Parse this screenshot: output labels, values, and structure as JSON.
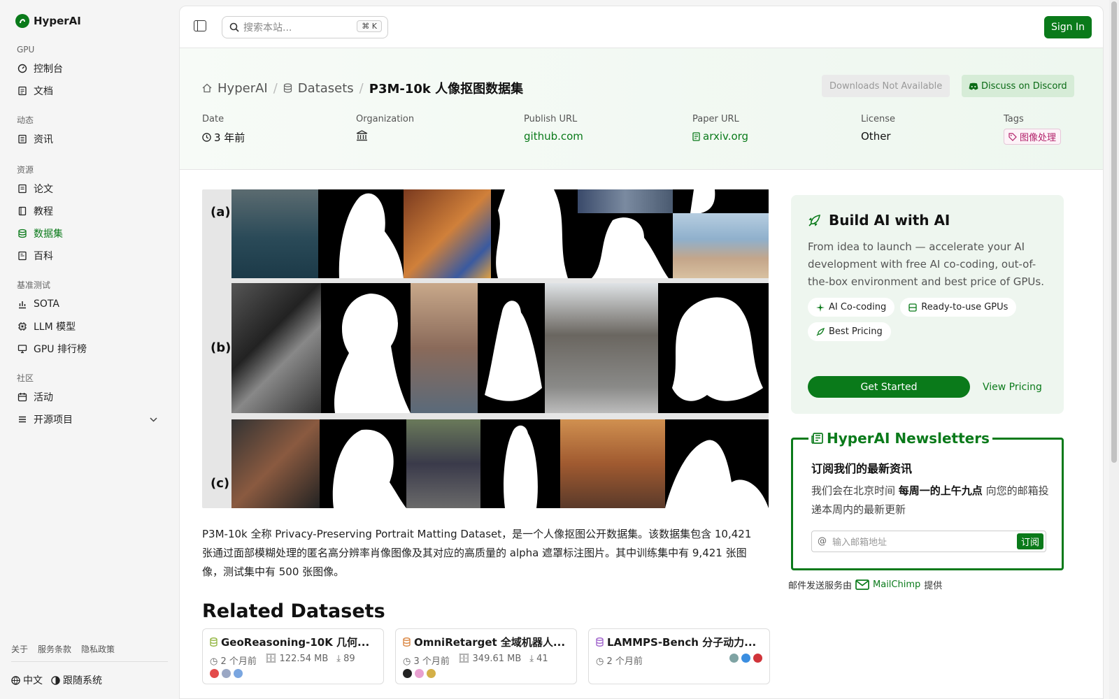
{
  "brand": {
    "name": "HyperAI"
  },
  "sidebar": {
    "groups": [
      {
        "heading": "GPU",
        "items": [
          {
            "label": "控制台",
            "icon": "gauge-icon"
          },
          {
            "label": "文档",
            "icon": "doc-icon"
          }
        ]
      },
      {
        "heading": "动态",
        "items": [
          {
            "label": "资讯",
            "icon": "news-icon"
          }
        ]
      },
      {
        "heading": "资源",
        "items": [
          {
            "label": "论文",
            "icon": "paper-icon"
          },
          {
            "label": "教程",
            "icon": "book-icon"
          },
          {
            "label": "数据集",
            "icon": "database-icon",
            "active": true
          },
          {
            "label": "百科",
            "icon": "wiki-icon"
          }
        ]
      },
      {
        "heading": "基准测试",
        "items": [
          {
            "label": "SOTA",
            "icon": "chart-icon"
          },
          {
            "label": "LLM 模型",
            "icon": "cpu-icon"
          },
          {
            "label": "GPU 排行榜",
            "icon": "monitor-icon"
          }
        ]
      },
      {
        "heading": "社区",
        "items": [
          {
            "label": "活动",
            "icon": "calendar-icon"
          },
          {
            "label": "开源项目",
            "icon": "list-icon",
            "chevron": true
          }
        ]
      }
    ],
    "footer_links": [
      "关于",
      "服务条款",
      "隐私政策"
    ],
    "language": "中文",
    "theme": "跟随系统"
  },
  "topbar": {
    "search_placeholder": "搜索本站...",
    "shortcut": "K",
    "signin": "Sign In"
  },
  "page": {
    "breadcrumb": [
      "HyperAI",
      "Datasets",
      "P3M-10k 人像抠图数据集"
    ],
    "downloads": "Downloads Not Available",
    "discord": "Discuss on Discord",
    "meta": {
      "date_label": "Date",
      "date": "3 年前",
      "org_label": "Organization",
      "publish_label": "Publish URL",
      "publish": "github.com",
      "paper_label": "Paper URL",
      "paper": "arxiv.org",
      "license_label": "License",
      "license": "Other",
      "tags_label": "Tags",
      "tag": "图像处理"
    },
    "image_rows": [
      "(a)",
      "(b)",
      "(c)"
    ],
    "description": "P3M-10k 全称 Privacy-Preserving Portrait Matting Dataset，是一个人像抠图公开数据集。该数据集包含 10,421 张通过面部模糊处理的匿名高分辨率肖像图像及其对应的高质量的 alpha 遮罩标注图片。其中训练集中有 9,421 张图像，测试集中有 500 张图像。",
    "related_title": "Related Datasets",
    "related": [
      {
        "title": "GeoReasoning-10K 几何...",
        "time": "2 个月前",
        "size": "122.54 MB",
        "downloads": "89",
        "color": "#8fb33a",
        "dots": [
          "#e34b4b",
          "#9aa7c4",
          "#7aa6e0"
        ]
      },
      {
        "title": "OmniRetarget 全域机器人...",
        "time": "3 个月前",
        "size": "349.61 MB",
        "downloads": "41",
        "color": "#d9813a",
        "dots": [
          "#222222",
          "#e8a0d0",
          "#d4b048"
        ]
      },
      {
        "title": "LAMMPS-Bench 分子动力...",
        "time": "2 个月前",
        "size": "",
        "downloads": "",
        "color": "#9b5cc9",
        "dots": [
          "#7fa3a3",
          "#3b8ee0",
          "#d0343a"
        ]
      }
    ]
  },
  "build": {
    "title": "Build AI with AI",
    "text": "From idea to launch — accelerate your AI development with free AI co-coding, out-of-the-box environment and best price of GPUs.",
    "chips": [
      "AI Co-coding",
      "Ready-to-use GPUs",
      "Best Pricing"
    ],
    "cta": "Get Started",
    "pricing": "View Pricing"
  },
  "newsletter": {
    "title": "HyperAI Newsletters",
    "heading": "订阅我们的最新资讯",
    "text_pre": "我们会在北京时间 ",
    "text_bold": "每周一的上午九点",
    "text_post": " 向您的邮箱投递本周内的最新更新",
    "placeholder": "输入邮箱地址",
    "button": "订阅",
    "provider_pre": "邮件发送服务由",
    "provider": "MailChimp",
    "provider_post": "提供"
  },
  "colors": {
    "accent": "#0a7a1a"
  }
}
